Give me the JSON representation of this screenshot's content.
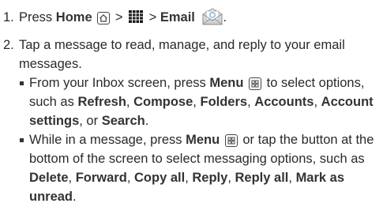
{
  "step1": {
    "number": "1.",
    "press": "Press",
    "home": "Home",
    "gt1": ">",
    "gt2": ">",
    "email": "Email",
    "end": "."
  },
  "step2": {
    "number": "2.",
    "text": "Tap a message to read, manage, and reply to your email messages."
  },
  "bullet1": {
    "t1": "From your Inbox screen, press",
    "menu": "Menu",
    "t2": "to select options, such as",
    "refresh": "Refresh",
    "c1": ",",
    "compose": "Compose",
    "c2": ",",
    "folders": "Folders",
    "c3": ",",
    "accounts": "Accounts",
    "c4": ",",
    "account_settings": "Account settings",
    "or": ", or",
    "search": "Search",
    "end": "."
  },
  "bullet2": {
    "t1": "While in a message, press",
    "menu": "Menu",
    "t2": "or tap the button at the bottom of the screen to select messaging options, such as",
    "delete": "Delete",
    "c1": ",",
    "forward": "Forward",
    "c2": ",",
    "copy_all": "Copy all",
    "c3": ",",
    "reply": "Reply",
    "c4": ",",
    "reply_all": "Reply all",
    "c5": ",",
    "mark_as_unread": "Mark as unread",
    "end": "."
  },
  "icons": {
    "home": "home-icon",
    "apps": "apps-grid-icon",
    "email": "email-app-icon",
    "menu": "menu-key-icon"
  }
}
